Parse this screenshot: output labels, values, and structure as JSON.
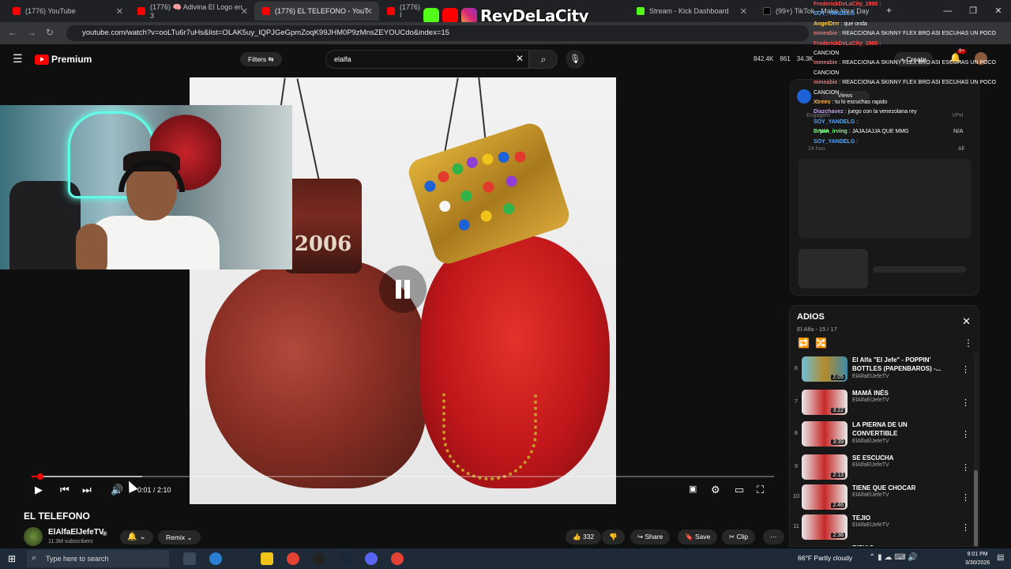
{
  "browser": {
    "tabs": [
      {
        "label": "(1776) YouTube",
        "type": "yt"
      },
      {
        "label": "(1776) 🧠 Adivina El Logo en 3",
        "type": "yt"
      },
      {
        "label": "(1776) EL TELEFONO - YouT",
        "type": "yt",
        "active": true
      },
      {
        "label": "(1776) I",
        "type": "yt"
      },
      {
        "label": "Stream - Kick Dashboard",
        "type": "kick"
      },
      {
        "label": "(99+) TikTok - Make Your Day",
        "type": "tt"
      }
    ],
    "url": "youtube.com/watch?v=ooLTu6r7uHs&list=OLAK5uy_lQPJGeGpmZoqK99JHM0P9zMnsZEYOUCdo&index=15"
  },
  "stream_overlay": {
    "brand": "ReyDeLaCity"
  },
  "youtube": {
    "logo": "Premium",
    "filters_label": "Filters",
    "search_value": "elalfa",
    "stats": [
      "842.4K",
      "861",
      "34.3K"
    ],
    "create_label": "Create",
    "notif_badge": "9+"
  },
  "video": {
    "cuff_text": "2006",
    "progress_fraction": 0.008,
    "time_current": "0:01",
    "time_total": "2:10",
    "title": "EL TELEFONO",
    "channel_name": "ElAlfaElJefeTV",
    "channel_subs": "11.3M subscribers",
    "remix_label": "Remix",
    "likes": "332",
    "share_label": "Share",
    "save_label": "Save",
    "clip_label": "Clip"
  },
  "chat": [
    {
      "user": "FrederickDeLaCity_1900",
      "msg": "",
      "color": "#ff4d4d"
    },
    {
      "user": "SOY_YANDELG",
      "msg": "",
      "color": "#4da6ff"
    },
    {
      "user": "AngelDrrr",
      "msg": "que onda",
      "color": "#ffd24d"
    },
    {
      "user": "mmeabie",
      "msg": "REACCIONA A SKINNY FLEX BRO ASI ESCUHAS UN POCO",
      "color": "#ff6b6b"
    },
    {
      "user": "FrederickDeLaCity_1900",
      "msg": "",
      "color": "#ff4d4d"
    },
    {
      "user": "",
      "msg": "CANCION",
      "color": "#ffffff"
    },
    {
      "user": "mmeabie",
      "msg": "REACCIONA A SKINNY FLEX BRO ASI ESCUHAS UN POCO",
      "color": "#ff6b6b"
    },
    {
      "user": "",
      "msg": "CANCION",
      "color": "#ffffff"
    },
    {
      "user": "mmeabie",
      "msg": "REACCIONA A SKINNY FLEX BRO ASI ESCUHAS UN POCO",
      "color": "#ff6b6b"
    },
    {
      "user": "",
      "msg": "CANCION",
      "color": "#ffffff"
    },
    {
      "user": "Xtrees",
      "msg": "tu lo escuchas rapido",
      "color": "#ffb347"
    },
    {
      "user": "Diazchavez",
      "msg": "juego con la venezolana rey",
      "color": "#c39bff"
    },
    {
      "user": "SOY_YANDELG",
      "msg": "",
      "color": "#4da6ff"
    },
    {
      "user": "Bryan_irving",
      "msg": "JAJAJAJJA QUE MMG",
      "color": "#6cff7a"
    },
    {
      "user": "SOY_YANDELG",
      "msg": "",
      "color": "#4da6ff"
    }
  ],
  "engagement": {
    "label": "Engagem",
    "vph": "VPH",
    "na1": "N/A",
    "na2": "N/A",
    "hours": "24 hou",
    "all": "All",
    "views": "Views"
  },
  "playlist": {
    "title": "ADIOS",
    "subtitle": "El Alfa - 15 / 17",
    "items": [
      {
        "idx": "6",
        "title": "El Alfa \"El Jefe\" - POPPIN' BOTTLES (PAPENBAROS) -...",
        "channel": "ElAlfaElJefeTV",
        "duration": "2:05",
        "first": true
      },
      {
        "idx": "7",
        "title": "MAMÁ INÉS",
        "channel": "ElAlfaElJefeTV",
        "duration": "3:22"
      },
      {
        "idx": "8",
        "title": "LA PIERNA DE UN CONVERTIBLE",
        "channel": "ElAlfaElJefeTV",
        "duration": "3:39"
      },
      {
        "idx": "9",
        "title": "SE ESCUCHA",
        "channel": "ElAlfaElJefeTV",
        "duration": "2:13"
      },
      {
        "idx": "10",
        "title": "TIENE QUE CHOCAR",
        "channel": "ElAlfaElJefeTV",
        "duration": "2:46"
      },
      {
        "idx": "11",
        "title": "TEJIO",
        "channel": "ElAlfaElJefeTV",
        "duration": "2:38"
      },
      {
        "idx": "",
        "title": "RIPIAO",
        "channel": "",
        "duration": ""
      }
    ]
  },
  "taskbar": {
    "search_placeholder": "Type here to search",
    "weather": "66°F  Partly cloudy",
    "time": "9:01 PM",
    "date": "3/30/2026"
  }
}
